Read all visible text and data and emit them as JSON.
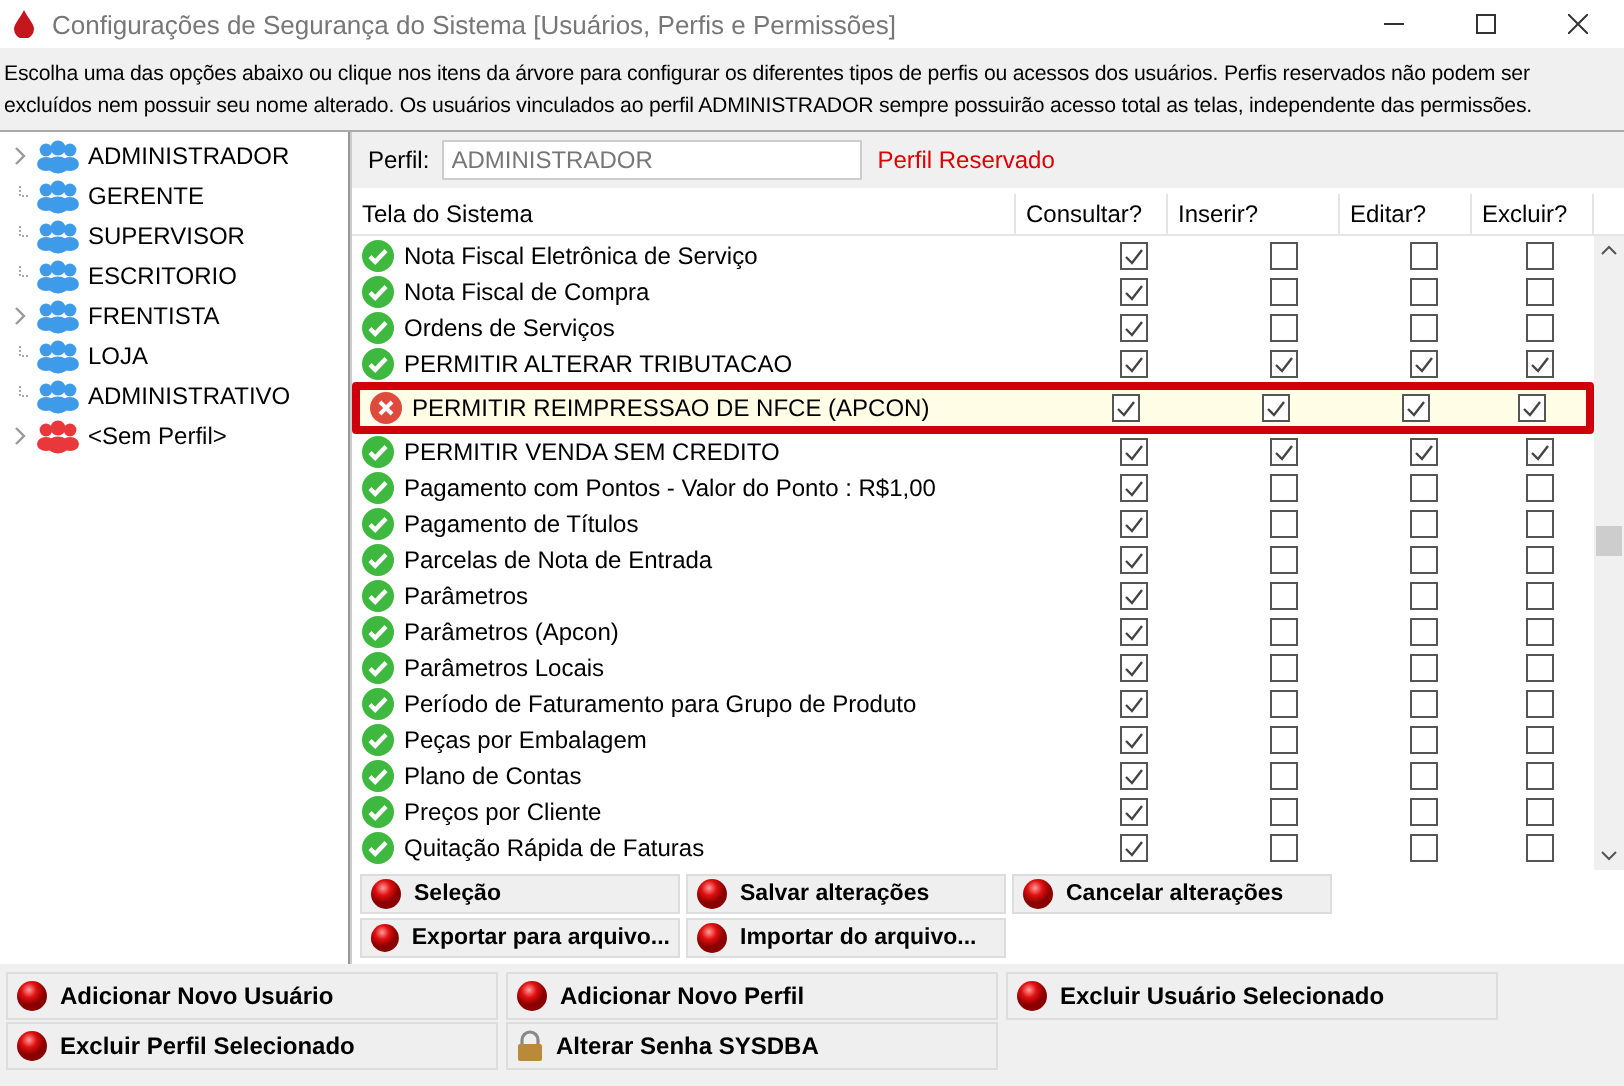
{
  "window": {
    "title": "Configurações de Segurança do Sistema [Usuários, Perfis e Permissões]"
  },
  "description": "Escolha uma das opções abaixo ou clique nos itens da árvore para configurar os diferentes tipos de perfis ou acessos dos usuários. Perfis reservados não podem ser excluídos nem possuir seu nome alterado. Os usuários vinculados ao perfil ADMINISTRADOR sempre possuirão acesso total as telas, independente das permissões.",
  "tree": [
    {
      "label": "ADMINISTRADOR",
      "expandable": true,
      "color": "#3d9be9",
      "selected": false
    },
    {
      "label": "GERENTE",
      "expandable": false,
      "color": "#3d9be9",
      "selected": false
    },
    {
      "label": "SUPERVISOR",
      "expandable": false,
      "color": "#3d9be9",
      "selected": false
    },
    {
      "label": "ESCRITORIO",
      "expandable": false,
      "color": "#3d9be9",
      "selected": false
    },
    {
      "label": "FRENTISTA",
      "expandable": true,
      "color": "#3d9be9",
      "selected": false
    },
    {
      "label": "LOJA",
      "expandable": false,
      "color": "#3d9be9",
      "selected": false
    },
    {
      "label": "ADMINISTRATIVO",
      "expandable": false,
      "color": "#3d9be9",
      "selected": false
    },
    {
      "label": "<Sem Perfil>",
      "expandable": true,
      "color": "#e8383b",
      "selected": false
    }
  ],
  "profile": {
    "label": "Perfil:",
    "value": "ADMINISTRADOR",
    "note": "Perfil Reservado"
  },
  "table": {
    "columns": [
      "Tela do Sistema",
      "Consultar?",
      "Inserir?",
      "Editar?",
      "Excluir?"
    ],
    "rows": [
      {
        "name": "Nota Fiscal Eletrônica de Serviço",
        "granted": true,
        "highlighted": false,
        "checks": [
          true,
          false,
          false,
          false
        ]
      },
      {
        "name": "Nota Fiscal de Compra",
        "granted": true,
        "highlighted": false,
        "checks": [
          true,
          false,
          false,
          false
        ]
      },
      {
        "name": "Ordens de Serviços",
        "granted": true,
        "highlighted": false,
        "checks": [
          true,
          false,
          false,
          false
        ]
      },
      {
        "name": "PERMITIR ALTERAR TRIBUTACAO",
        "granted": true,
        "highlighted": false,
        "checks": [
          true,
          true,
          true,
          true
        ]
      },
      {
        "name": "PERMITIR REIMPRESSAO DE NFCE (APCON)",
        "granted": false,
        "highlighted": true,
        "checks": [
          true,
          true,
          true,
          true
        ]
      },
      {
        "name": "PERMITIR VENDA SEM CREDITO",
        "granted": true,
        "highlighted": false,
        "checks": [
          true,
          true,
          true,
          true
        ]
      },
      {
        "name": "Pagamento com Pontos - Valor do Ponto : R$1,00",
        "granted": true,
        "highlighted": false,
        "checks": [
          true,
          false,
          false,
          false
        ]
      },
      {
        "name": "Pagamento de Títulos",
        "granted": true,
        "highlighted": false,
        "checks": [
          true,
          false,
          false,
          false
        ]
      },
      {
        "name": "Parcelas de Nota de Entrada",
        "granted": true,
        "highlighted": false,
        "checks": [
          true,
          false,
          false,
          false
        ]
      },
      {
        "name": "Parâmetros",
        "granted": true,
        "highlighted": false,
        "checks": [
          true,
          false,
          false,
          false
        ]
      },
      {
        "name": "Parâmetros (Apcon)",
        "granted": true,
        "highlighted": false,
        "checks": [
          true,
          false,
          false,
          false
        ]
      },
      {
        "name": "Parâmetros Locais",
        "granted": true,
        "highlighted": false,
        "checks": [
          true,
          false,
          false,
          false
        ]
      },
      {
        "name": "Período de Faturamento para Grupo de Produto",
        "granted": true,
        "highlighted": false,
        "checks": [
          true,
          false,
          false,
          false
        ]
      },
      {
        "name": "Peças por Embalagem",
        "granted": true,
        "highlighted": false,
        "checks": [
          true,
          false,
          false,
          false
        ]
      },
      {
        "name": "Plano de Contas",
        "granted": true,
        "highlighted": false,
        "checks": [
          true,
          false,
          false,
          false
        ]
      },
      {
        "name": "Preços por Cliente",
        "granted": true,
        "highlighted": false,
        "checks": [
          true,
          false,
          false,
          false
        ]
      },
      {
        "name": "Quitação Rápida de Faturas",
        "granted": true,
        "highlighted": false,
        "checks": [
          true,
          false,
          false,
          false
        ]
      }
    ]
  },
  "panel_buttons": [
    {
      "label": "Seleção",
      "kind": "ball"
    },
    {
      "label": "Salvar alterações",
      "kind": "ball"
    },
    {
      "label": "Cancelar alterações",
      "kind": "ball"
    },
    {
      "label": "Exportar para arquivo...",
      "kind": "ball"
    },
    {
      "label": "Importar do arquivo...",
      "kind": "ball"
    }
  ],
  "bottom_buttons": [
    {
      "label": "Adicionar Novo Usuário",
      "kind": "ball"
    },
    {
      "label": "Adicionar Novo Perfil",
      "kind": "ball"
    },
    {
      "label": "Excluir Usuário Selecionado",
      "kind": "ball"
    },
    {
      "label": "Excluir Perfil Selecionado",
      "kind": "ball"
    },
    {
      "label": "Alterar Senha SYSDBA",
      "kind": "lock"
    }
  ]
}
